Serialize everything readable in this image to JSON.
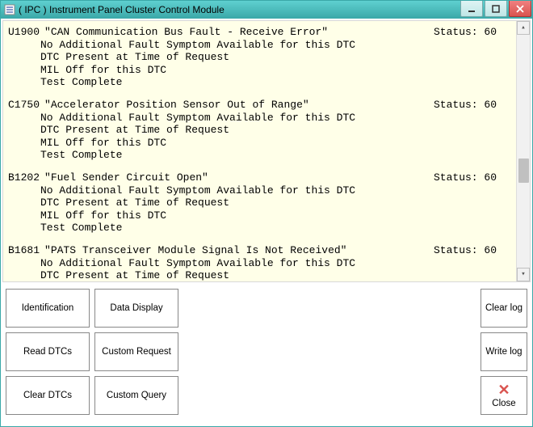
{
  "window": {
    "title": "( IPC ) Instrument Panel Cluster Control Module"
  },
  "dtcs": [
    {
      "code": "U1900",
      "desc": "\"CAN Communication Bus Fault - Receive Error\"",
      "status": "Status: 60",
      "lines": [
        "No Additional Fault Symptom Available for this DTC",
        "DTC Present at Time of Request",
        "MIL Off for this DTC",
        "Test Complete"
      ]
    },
    {
      "code": "C1750",
      "desc": "\"Accelerator Position Sensor Out of Range\"",
      "status": "Status: 60",
      "lines": [
        "No Additional Fault Symptom Available for this DTC",
        "DTC Present at Time of Request",
        "MIL Off for this DTC",
        "Test Complete"
      ]
    },
    {
      "code": "B1202",
      "desc": "\"Fuel Sender Circuit Open\"",
      "status": "Status: 60",
      "lines": [
        "No Additional Fault Symptom Available for this DTC",
        "DTC Present at Time of Request",
        "MIL Off for this DTC",
        "Test Complete"
      ]
    },
    {
      "code": "B1681",
      "desc": "\"PATS Transceiver Module Signal Is Not Received\"",
      "status": "Status: 60",
      "lines": [
        "No Additional Fault Symptom Available for this DTC",
        "DTC Present at Time of Request"
      ]
    }
  ],
  "buttons": {
    "identification": "Identification",
    "data_display": "Data Display",
    "read_dtcs": "Read DTCs",
    "custom_request": "Custom Request",
    "clear_dtcs": "Clear DTCs",
    "custom_query": "Custom Query",
    "clear_log": "Clear log",
    "write_log": "Write log",
    "close": "Close"
  }
}
